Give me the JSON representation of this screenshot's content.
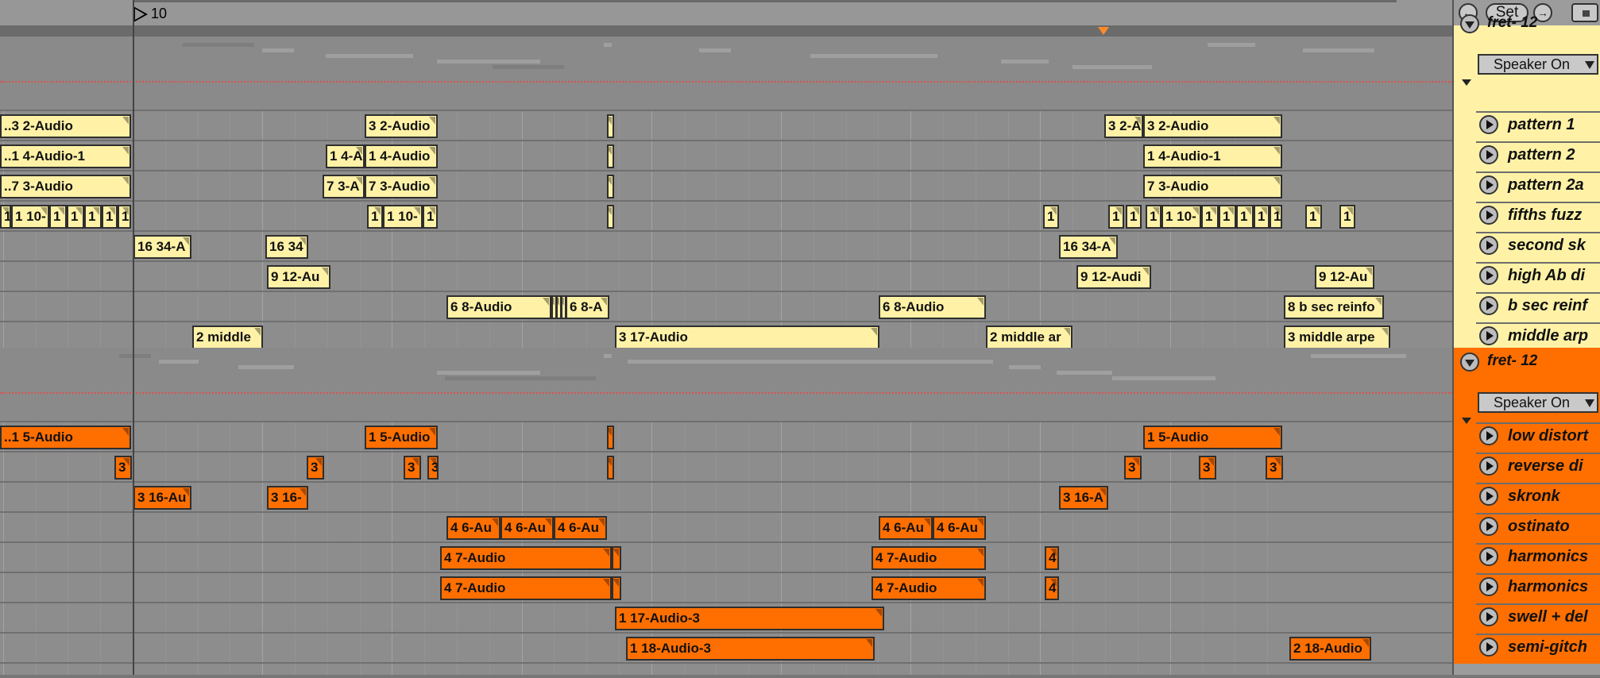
{
  "ruler": {
    "bar_number": "10"
  },
  "groups": [
    {
      "name": "fret- 12",
      "color": "#fff2a6",
      "output": "Speaker On",
      "tracks": [
        {
          "name": "pattern 1",
          "clips": [
            {
              "label": "..3 2-Audio",
              "start": 0,
              "end": 165
            },
            {
              "label": "3 2-Audio",
              "start": 459,
              "end": 551
            },
            {
              "label": "",
              "start": 764,
              "end": 773
            },
            {
              "label": "3 2-A",
              "start": 1390,
              "end": 1439
            },
            {
              "label": "3 2-Audio",
              "start": 1439,
              "end": 1614
            }
          ]
        },
        {
          "name": "pattern 2",
          "clips": [
            {
              "label": "..1 4-Audio-1",
              "start": 0,
              "end": 165
            },
            {
              "label": "1 4-A",
              "start": 410,
              "end": 459
            },
            {
              "label": "1 4-Audio",
              "start": 459,
              "end": 551
            },
            {
              "label": "",
              "start": 764,
              "end": 773
            },
            {
              "label": "1 4-Audio-1",
              "start": 1439,
              "end": 1614
            }
          ]
        },
        {
          "name": "pattern 2a",
          "clips": [
            {
              "label": "..7 3-Audio",
              "start": 0,
              "end": 165
            },
            {
              "label": "7 3-A",
              "start": 406,
              "end": 459
            },
            {
              "label": "7 3-Audio",
              "start": 459,
              "end": 551
            },
            {
              "label": "",
              "start": 764,
              "end": 773
            },
            {
              "label": "7 3-Audio",
              "start": 1439,
              "end": 1614
            }
          ]
        },
        {
          "name": "fifths fuzz",
          "clips": [
            {
              "label": "1",
              "start": 0,
              "end": 14
            },
            {
              "label": "1 10-",
              "start": 14,
              "end": 62
            },
            {
              "label": "1",
              "start": 62,
              "end": 84
            },
            {
              "label": "1",
              "start": 84,
              "end": 106
            },
            {
              "label": "1",
              "start": 106,
              "end": 128
            },
            {
              "label": "1",
              "start": 128,
              "end": 148
            },
            {
              "label": "1",
              "start": 148,
              "end": 165
            },
            {
              "label": "1",
              "start": 462,
              "end": 482
            },
            {
              "label": "1 10-",
              "start": 482,
              "end": 532
            },
            {
              "label": "1",
              "start": 532,
              "end": 551
            },
            {
              "label": "",
              "start": 764,
              "end": 773
            },
            {
              "label": "1",
              "start": 1313,
              "end": 1333
            },
            {
              "label": "1",
              "start": 1395,
              "end": 1415
            },
            {
              "label": "1",
              "start": 1417,
              "end": 1437
            },
            {
              "label": "1",
              "start": 1442,
              "end": 1462
            },
            {
              "label": "1 10-",
              "start": 1462,
              "end": 1512
            },
            {
              "label": "1",
              "start": 1512,
              "end": 1534
            },
            {
              "label": "1",
              "start": 1534,
              "end": 1556
            },
            {
              "label": "1",
              "start": 1556,
              "end": 1578
            },
            {
              "label": "1",
              "start": 1578,
              "end": 1598
            },
            {
              "label": "1",
              "start": 1598,
              "end": 1614
            },
            {
              "label": "1",
              "start": 1643,
              "end": 1664
            },
            {
              "label": "1",
              "start": 1686,
              "end": 1706
            }
          ]
        },
        {
          "name": "second sk",
          "clips": [
            {
              "label": "16 34-A",
              "start": 168,
              "end": 241
            },
            {
              "label": "16 34",
              "start": 334,
              "end": 388
            },
            {
              "label": "16 34-A",
              "start": 1333,
              "end": 1407
            }
          ]
        },
        {
          "name": "high Ab di",
          "clips": [
            {
              "label": "9 12-Au",
              "start": 336,
              "end": 416
            },
            {
              "label": "9 12-Audi",
              "start": 1355,
              "end": 1449
            },
            {
              "label": "9 12-Au",
              "start": 1655,
              "end": 1730
            }
          ]
        },
        {
          "name": "b sec reinf",
          "clips": [
            {
              "label": "6 8-Audio",
              "start": 562,
              "end": 694
            },
            {
              "label": "",
              "start": 694,
              "end": 700
            },
            {
              "label": "",
              "start": 700,
              "end": 706
            },
            {
              "label": "",
              "start": 706,
              "end": 712
            },
            {
              "label": "6 8-A",
              "start": 712,
              "end": 767
            },
            {
              "label": "6 8-Audio",
              "start": 1106,
              "end": 1241
            },
            {
              "label": "8 b sec reinfo",
              "start": 1616,
              "end": 1742
            }
          ]
        },
        {
          "name": "middle arp",
          "clips": [
            {
              "label": "2 middle",
              "start": 242,
              "end": 331
            },
            {
              "label": "3 17-Audio",
              "start": 774,
              "end": 1107
            },
            {
              "label": "2 middle ar",
              "start": 1241,
              "end": 1350
            },
            {
              "label": "3 middle arpe",
              "start": 1616,
              "end": 1750
            }
          ]
        }
      ]
    },
    {
      "name": "fret- 12",
      "color": "#ff6f00",
      "output": "Speaker On",
      "tracks": [
        {
          "name": "low distort",
          "clips": [
            {
              "label": "..1 5-Audio",
              "start": 0,
              "end": 165
            },
            {
              "label": "1 5-Audio",
              "start": 459,
              "end": 551
            },
            {
              "label": "",
              "start": 764,
              "end": 773
            },
            {
              "label": "1 5-Audio",
              "start": 1439,
              "end": 1614
            }
          ]
        },
        {
          "name": "reverse di",
          "clips": [
            {
              "label": "3",
              "start": 144,
              "end": 166
            },
            {
              "label": "3",
              "start": 386,
              "end": 408
            },
            {
              "label": "3",
              "start": 508,
              "end": 530
            },
            {
              "label": "3",
              "start": 538,
              "end": 552
            },
            {
              "label": "",
              "start": 764,
              "end": 773
            },
            {
              "label": "3",
              "start": 1415,
              "end": 1437
            },
            {
              "label": "3",
              "start": 1509,
              "end": 1531
            },
            {
              "label": "3",
              "start": 1593,
              "end": 1615
            }
          ]
        },
        {
          "name": "skronk",
          "clips": [
            {
              "label": "3 16-Au",
              "start": 168,
              "end": 241
            },
            {
              "label": "3 16-",
              "start": 336,
              "end": 388
            },
            {
              "label": "3 16-A",
              "start": 1333,
              "end": 1395
            }
          ]
        },
        {
          "name": "ostinato",
          "clips": [
            {
              "label": "4 6-Au",
              "start": 562,
              "end": 630
            },
            {
              "label": "4 6-Au",
              "start": 630,
              "end": 697
            },
            {
              "label": "4 6-Au",
              "start": 697,
              "end": 764
            },
            {
              "label": "4 6-Au",
              "start": 1106,
              "end": 1174
            },
            {
              "label": "4 6-Au",
              "start": 1174,
              "end": 1241
            }
          ]
        },
        {
          "name": "harmonics",
          "clips": [
            {
              "label": "4 7-Audio",
              "start": 554,
              "end": 770
            },
            {
              "label": "",
              "start": 770,
              "end": 782
            },
            {
              "label": "4 7-Audio",
              "start": 1097,
              "end": 1241
            },
            {
              "label": "4",
              "start": 1315,
              "end": 1333
            }
          ]
        },
        {
          "name": "harmonics",
          "clips": [
            {
              "label": "4 7-Audio",
              "start": 554,
              "end": 770
            },
            {
              "label": "",
              "start": 770,
              "end": 782
            },
            {
              "label": "4 7-Audio",
              "start": 1097,
              "end": 1241
            },
            {
              "label": "4",
              "start": 1315,
              "end": 1333
            }
          ]
        },
        {
          "name": "swell + del",
          "clips": [
            {
              "label": "1 17-Audio-3",
              "start": 774,
              "end": 1113
            }
          ]
        },
        {
          "name": "semi-gitch",
          "clips": [
            {
              "label": "1 18-Audio-3",
              "start": 788,
              "end": 1101
            },
            {
              "label": "2 18-Audio",
              "start": 1623,
              "end": 1726
            }
          ]
        }
      ]
    }
  ]
}
